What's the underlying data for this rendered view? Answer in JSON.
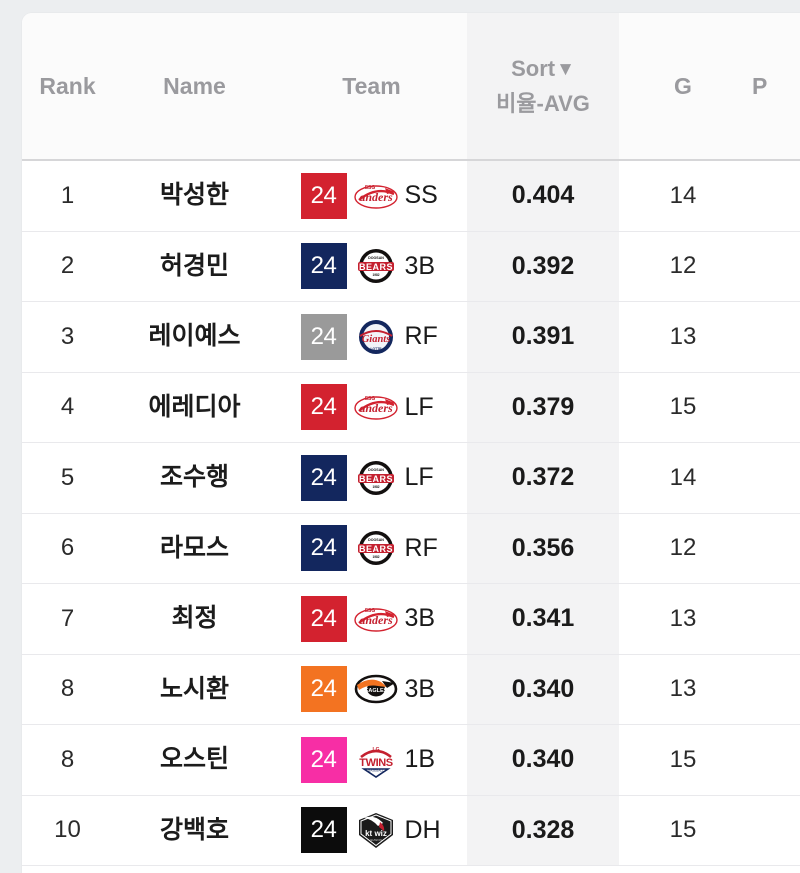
{
  "table": {
    "headers": {
      "rank": "Rank",
      "name": "Name",
      "team": "Team",
      "sort_label": "Sort",
      "sort_caret": "▼",
      "stat_label": "비율-AVG",
      "games": "G",
      "next_partial": "P"
    },
    "rows": [
      {
        "rank": "1",
        "name": "박성한",
        "jersey": "24",
        "team_code": "SSG",
        "team_name": "SSG Landers",
        "badge_color": "#d3222f",
        "position": "SS",
        "avg": "0.404",
        "g": "14"
      },
      {
        "rank": "2",
        "name": "허경민",
        "jersey": "24",
        "team_code": "OB",
        "team_name": "Doosan Bears",
        "badge_color": "#13275e",
        "position": "3B",
        "avg": "0.392",
        "g": "12"
      },
      {
        "rank": "3",
        "name": "레이예스",
        "jersey": "24",
        "team_code": "LT",
        "team_name": "Lotte Giants",
        "badge_color": "#9a9a9a",
        "position": "RF",
        "avg": "0.391",
        "g": "13"
      },
      {
        "rank": "4",
        "name": "에레디아",
        "jersey": "24",
        "team_code": "SSG",
        "team_name": "SSG Landers",
        "badge_color": "#d3222f",
        "position": "LF",
        "avg": "0.379",
        "g": "15"
      },
      {
        "rank": "5",
        "name": "조수행",
        "jersey": "24",
        "team_code": "OB",
        "team_name": "Doosan Bears",
        "badge_color": "#13275e",
        "position": "LF",
        "avg": "0.372",
        "g": "14"
      },
      {
        "rank": "6",
        "name": "라모스",
        "jersey": "24",
        "team_code": "OB",
        "team_name": "Doosan Bears",
        "badge_color": "#13275e",
        "position": "RF",
        "avg": "0.356",
        "g": "12"
      },
      {
        "rank": "7",
        "name": "최정",
        "jersey": "24",
        "team_code": "SSG",
        "team_name": "SSG Landers",
        "badge_color": "#d3222f",
        "position": "3B",
        "avg": "0.341",
        "g": "13"
      },
      {
        "rank": "8",
        "name": "노시환",
        "jersey": "24",
        "team_code": "HH",
        "team_name": "Hanwha Eagles",
        "badge_color": "#f37321",
        "position": "3B",
        "avg": "0.340",
        "g": "13"
      },
      {
        "rank": "8",
        "name": "오스틴",
        "jersey": "24",
        "team_code": "LG",
        "team_name": "LG Twins",
        "badge_color": "#f72ea5",
        "position": "1B",
        "avg": "0.340",
        "g": "15"
      },
      {
        "rank": "10",
        "name": "강백호",
        "jersey": "24",
        "team_code": "KT",
        "team_name": "kt wiz",
        "badge_color": "#0c0c0c",
        "position": "DH",
        "avg": "0.328",
        "g": "15"
      }
    ]
  },
  "colors": {
    "page_background": "#eceef0",
    "card_background": "#ffffff",
    "header_background": "#fbfbfb",
    "highlight_column": "#f3f3f4",
    "header_text": "#9a9a9e",
    "body_text": "#1a1a1a",
    "row_divider": "#e9e9ec",
    "header_divider": "#d6d6d8"
  }
}
